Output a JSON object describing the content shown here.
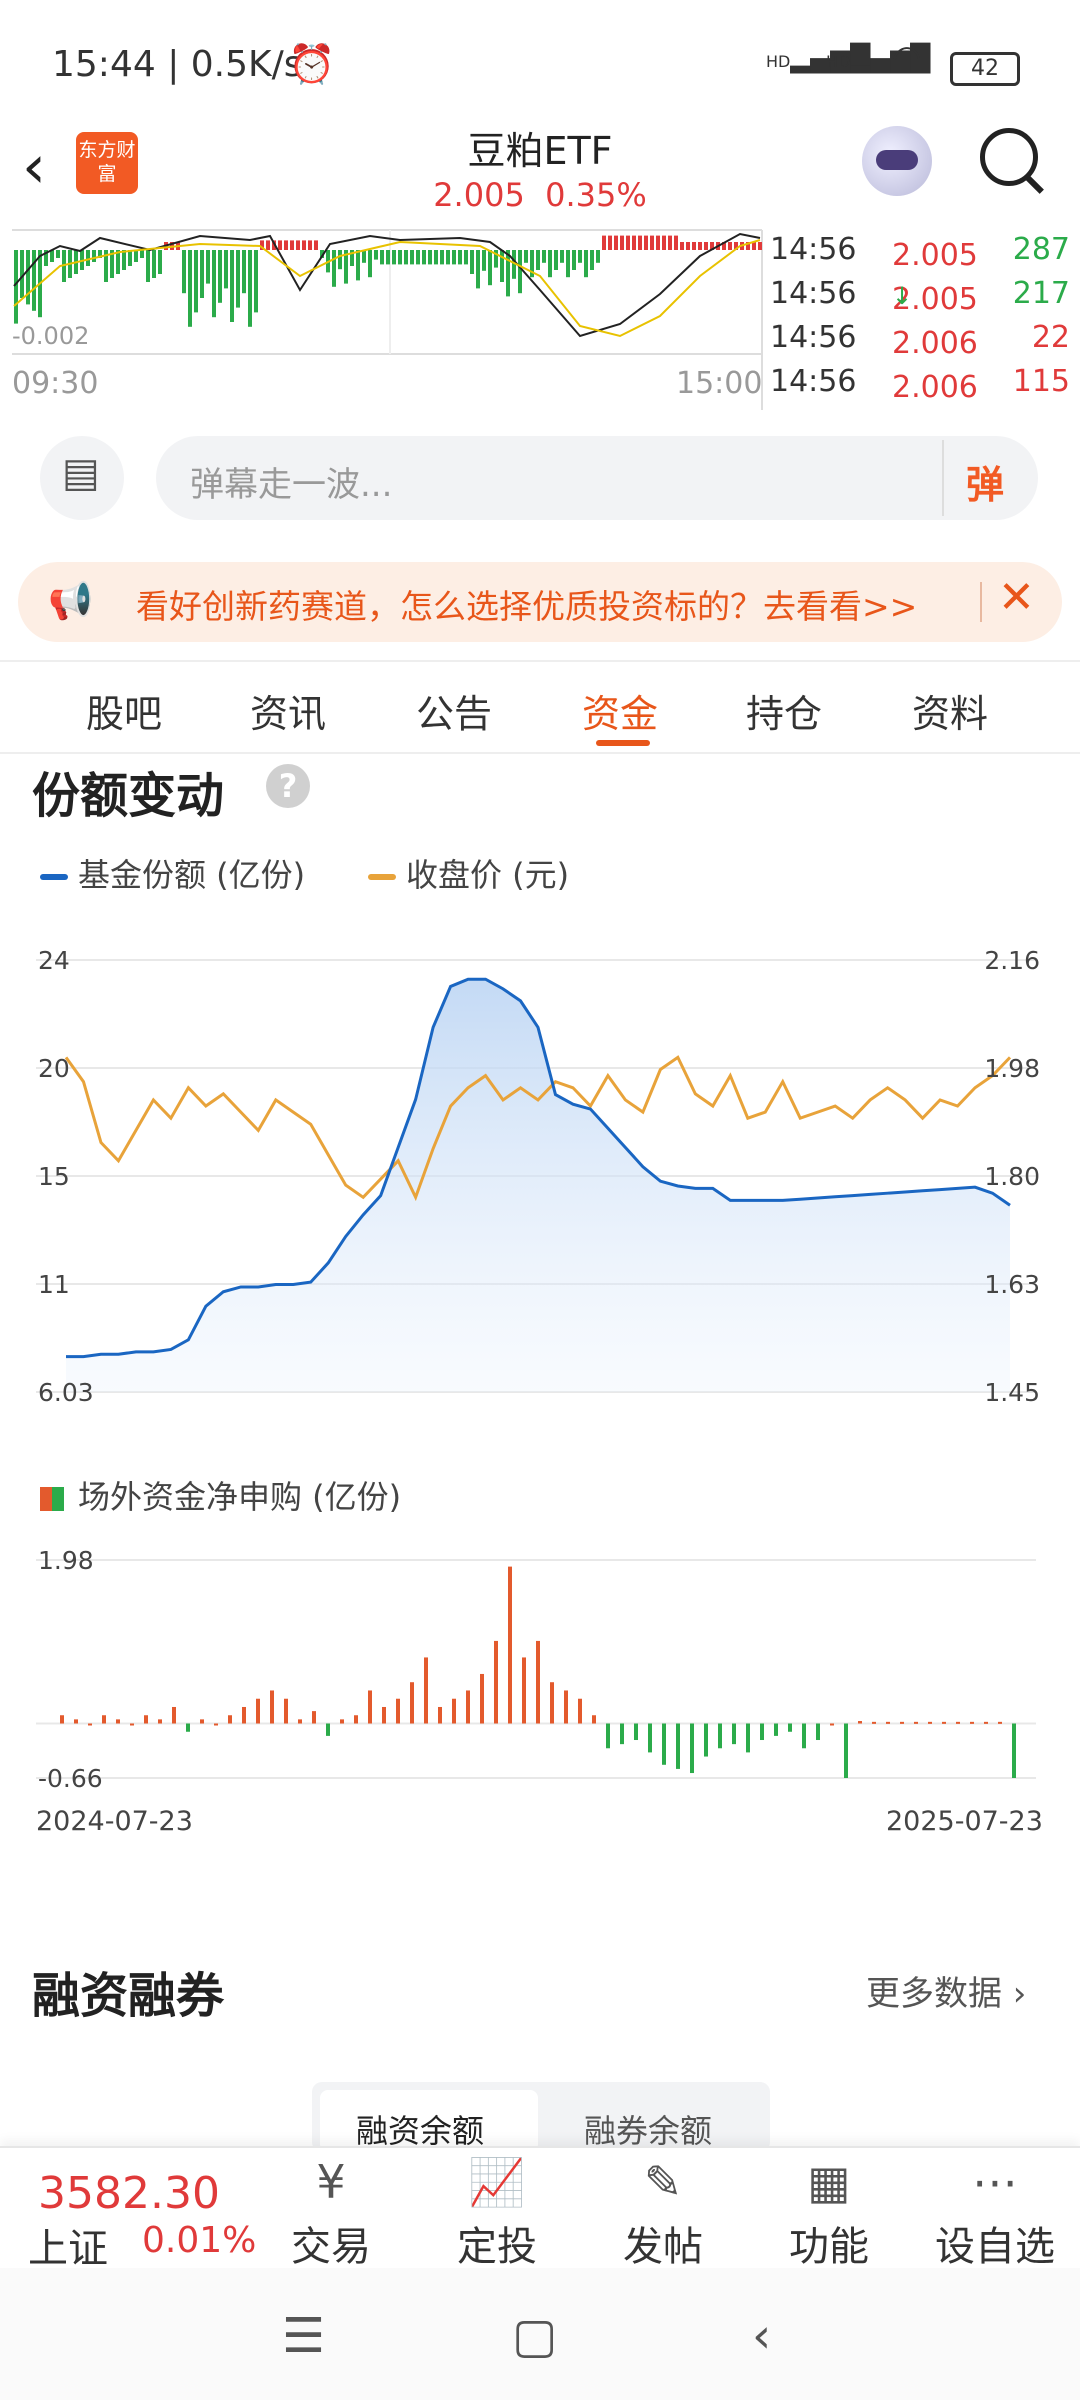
{
  "status_bar": {
    "time": "15:44",
    "speed": "0.5K/s",
    "signal1": "HD",
    "signal2": "HD",
    "battery": "42"
  },
  "header": {
    "logo_text": "东方财富",
    "title": "豆粕ETF",
    "price": "2.005",
    "change_pct": "0.35%"
  },
  "mini_chart": {
    "left_low_label": "-0.002",
    "time_start": "09:30",
    "time_end": "15:00"
  },
  "ticks": [
    {
      "time": "14:56",
      "price": "2.005",
      "volume": "287",
      "arrow": ""
    },
    {
      "time": "14:56",
      "price": "2.005",
      "volume": "217",
      "arrow": "↓"
    },
    {
      "time": "14:56",
      "price": "2.006",
      "volume": "22",
      "arrow": ""
    },
    {
      "time": "14:56",
      "price": "2.006",
      "volume": "115",
      "arrow": ""
    }
  ],
  "danmu": {
    "placeholder": "弹幕走一波...",
    "button": "弹"
  },
  "banner": {
    "text": "看好创新药赛道，怎么选择优质投资标的？去看看>>"
  },
  "tabs": [
    {
      "label": "股吧",
      "active": false
    },
    {
      "label": "资讯",
      "active": false
    },
    {
      "label": "公告",
      "active": false
    },
    {
      "label": "资金",
      "active": true
    },
    {
      "label": "持仓",
      "active": false
    },
    {
      "label": "资料",
      "active": false
    }
  ],
  "share_section": {
    "title": "份额变动",
    "help": "?",
    "legend_share": "基金份额 (亿份)",
    "legend_price": "收盘价 (元)"
  },
  "flow_section": {
    "legend": "场外资金净申购 (亿份)",
    "date_start": "2024-07-23",
    "date_end": "2025-07-23"
  },
  "chart_data": [
    {
      "type": "line",
      "title": "份额变动",
      "x_range": [
        "2024-07-23",
        "2025-07-23"
      ],
      "left_axis_ticks": [
        "24",
        "20",
        "15",
        "11",
        "6.03"
      ],
      "right_axis_ticks": [
        "2.16",
        "1.98",
        "1.80",
        "1.63",
        "1.45"
      ],
      "ylim_left": [
        6.03,
        24
      ],
      "ylim_right": [
        1.45,
        2.16
      ],
      "grid": true,
      "series": [
        {
          "name": "基金份额 (亿份)",
          "color": "#1a66c2",
          "axis": "left",
          "values": [
            7.5,
            7.5,
            7.6,
            7.6,
            7.7,
            7.7,
            7.8,
            8.2,
            9.6,
            10.2,
            10.4,
            10.4,
            10.5,
            10.5,
            10.6,
            11.4,
            12.5,
            13.4,
            14.2,
            16.2,
            18.2,
            21.2,
            22.9,
            23.2,
            23.2,
            22.8,
            22.3,
            21.2,
            18.4,
            18.0,
            17.8,
            17.0,
            16.2,
            15.4,
            14.8,
            14.6,
            14.5,
            14.5,
            14.0,
            14.0,
            14.0,
            14.0,
            14.05,
            14.1,
            14.15,
            14.2,
            14.25,
            14.3,
            14.35,
            14.4,
            14.45,
            14.5,
            14.55,
            14.3,
            13.8
          ]
        },
        {
          "name": "收盘价 (元)",
          "color": "#e8a33a",
          "axis": "right",
          "values": [
            2.0,
            1.96,
            1.86,
            1.83,
            1.88,
            1.93,
            1.9,
            1.95,
            1.92,
            1.94,
            1.91,
            1.88,
            1.93,
            1.91,
            1.89,
            1.84,
            1.79,
            1.77,
            1.8,
            1.83,
            1.77,
            1.85,
            1.92,
            1.95,
            1.97,
            1.93,
            1.95,
            1.93,
            1.96,
            1.95,
            1.92,
            1.97,
            1.93,
            1.91,
            1.98,
            2.0,
            1.94,
            1.92,
            1.97,
            1.9,
            1.91,
            1.96,
            1.9,
            1.91,
            1.92,
            1.9,
            1.93,
            1.95,
            1.93,
            1.9,
            1.93,
            1.92,
            1.95,
            1.97,
            2.0
          ]
        }
      ]
    },
    {
      "type": "bar",
      "title": "场外资金净申购 (亿份)",
      "x_range": [
        "2024-07-23",
        "2025-07-23"
      ],
      "ylim": [
        -0.66,
        1.98
      ],
      "y_ticks": [
        "1.98",
        "-0.66"
      ],
      "colors": {
        "positive": "#e35a2d",
        "negative": "#2bab4a"
      },
      "values": [
        0.1,
        0.05,
        0,
        0.1,
        0.05,
        0,
        0.1,
        0.05,
        0.2,
        -0.1,
        0.05,
        0,
        0.1,
        0.2,
        0.3,
        0.4,
        0.3,
        0.05,
        0.15,
        -0.15,
        0.05,
        0.1,
        0.4,
        0.2,
        0.3,
        0.5,
        0.8,
        0.2,
        0.3,
        0.4,
        0.6,
        1.0,
        1.9,
        0.8,
        1.0,
        0.5,
        0.4,
        0.3,
        0.1,
        -0.3,
        -0.25,
        -0.2,
        -0.35,
        -0.5,
        -0.55,
        -0.6,
        -0.4,
        -0.3,
        -0.25,
        -0.35,
        -0.2,
        -0.15,
        -0.1,
        -0.3,
        -0.2,
        0,
        -0.66,
        0.03,
        0.02,
        0.02,
        0.02,
        0.02,
        0.02,
        0.02,
        0.02,
        0.02,
        0.02,
        0.02,
        -0.66
      ]
    }
  ],
  "margin_section": {
    "title": "融资融券",
    "more": "更多数据 ›",
    "seg_active": "融资余额",
    "seg_other": "融券余额"
  },
  "bottom_bar": {
    "index_value": "3582.30",
    "index_name": "上证",
    "index_pct": "0.01%",
    "items": [
      {
        "icon": "trade-icon",
        "label": "交易"
      },
      {
        "icon": "invest-icon",
        "label": "定投"
      },
      {
        "icon": "post-icon",
        "label": "发帖"
      },
      {
        "icon": "function-icon",
        "label": "功能"
      },
      {
        "icon": "watchlist-icon",
        "label": "设自选"
      }
    ]
  },
  "colors": {
    "accent": "#e8561a",
    "up": "#e03a3a",
    "down": "#2bab4a",
    "share_line": "#1a66c2",
    "price_line": "#e8a33a"
  }
}
